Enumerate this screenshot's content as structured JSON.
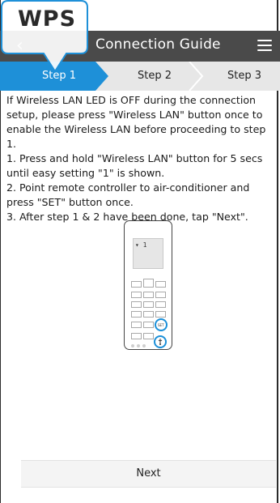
{
  "header": {
    "title": "Connection Guide",
    "back_glyph": "‹",
    "menu_icon": "hamburger-menu-icon"
  },
  "steps": [
    {
      "label": "Step 1",
      "active": true
    },
    {
      "label": "Step 2",
      "active": false
    },
    {
      "label": "Step 3",
      "active": false
    }
  ],
  "instructions": "If Wireless LAN LED is OFF during the connection setup, please press \"Wireless LAN\" button once to enable the Wireless LAN before proceeding to step 1.\n1. Press and hold \"Wireless LAN\" button for 5 secs until easy setting \"1\" is shown.\n2. Point remote controller to air-conditioner and press \"SET\" button once.\n3. After step 1 & 2 have been done, tap \"Next\".",
  "remote": {
    "lcd_text": "▾ 1",
    "set_label": "SET"
  },
  "next_label": "Next",
  "callout": {
    "label": "WPS"
  },
  "colors": {
    "header_bg": "#4a4a4a",
    "step_active": "#1e90d8",
    "step_bar_bg": "#e7e7e7",
    "highlight_ring": "#1b8fd8"
  }
}
